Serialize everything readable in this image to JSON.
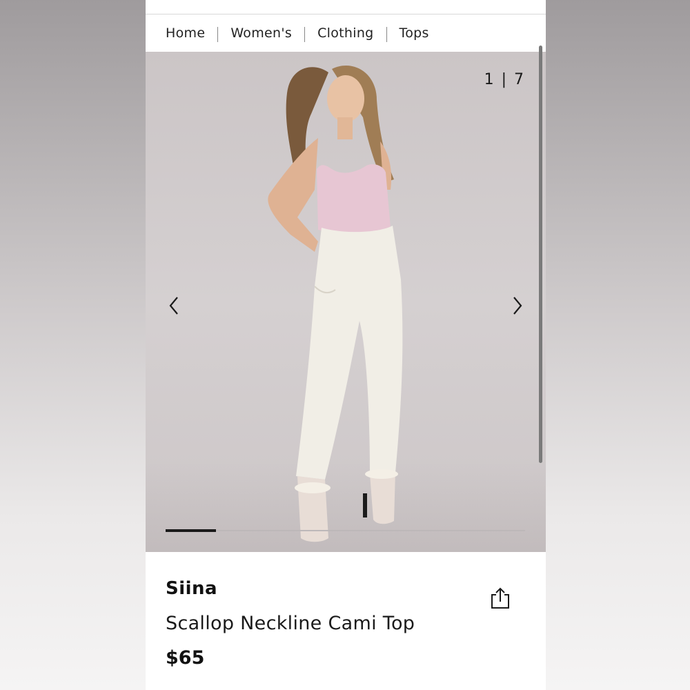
{
  "breadcrumb": [
    "Home",
    "Women's",
    "Clothing",
    "Tops"
  ],
  "gallery": {
    "counter": "1 | 7",
    "current": 1,
    "total": 7,
    "progress": 0.14,
    "prev_icon": "chevron-left-icon",
    "next_icon": "chevron-right-icon"
  },
  "product": {
    "brand": "Siina",
    "title": "Scallop Neckline Cami Top",
    "price": "$65",
    "share_icon": "share-icon"
  },
  "colors": {
    "background": "#cbc5c6",
    "top": "#e7c6d3",
    "jeans": "#f1eee6",
    "text": "#111111"
  }
}
